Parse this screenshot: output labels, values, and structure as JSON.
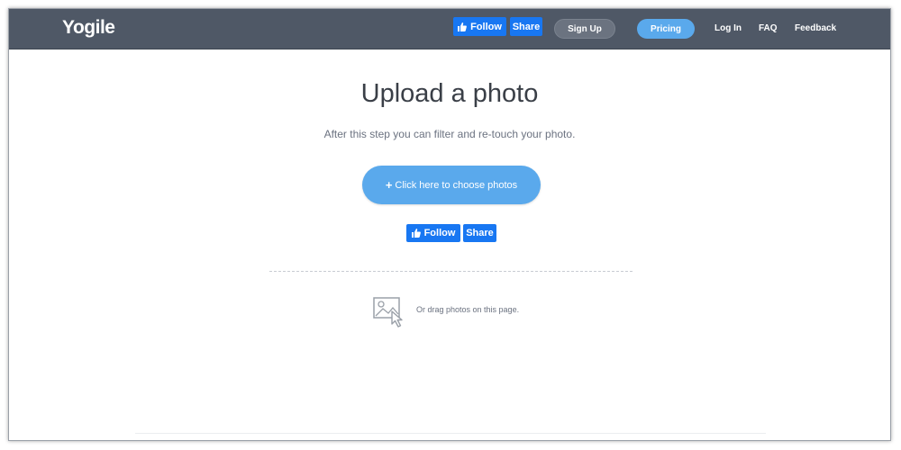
{
  "header": {
    "logo": "Yogile",
    "fb_follow_label": "Follow",
    "fb_share_label": "Share",
    "signup_label": "Sign Up",
    "pricing_label": "Pricing",
    "login_label": "Log In",
    "faq_label": "FAQ",
    "feedback_label": "Feedback"
  },
  "main": {
    "title": "Upload a photo",
    "subtitle": "After this step you can filter and re-touch your photo.",
    "choose_plus": "+",
    "choose_label": "Click here to choose photos",
    "fb_follow_label": "Follow",
    "fb_share_label": "Share",
    "drag_text": "Or drag photos on this page."
  },
  "icons": {
    "thumb": "thumbs-up-icon",
    "plus": "plus-icon",
    "drag": "image-drag-icon"
  },
  "colors": {
    "navbar": "#4f5866",
    "facebook_blue": "#1877f2",
    "accent_blue": "#5aa9ec",
    "signup_gray": "#6b7380"
  }
}
